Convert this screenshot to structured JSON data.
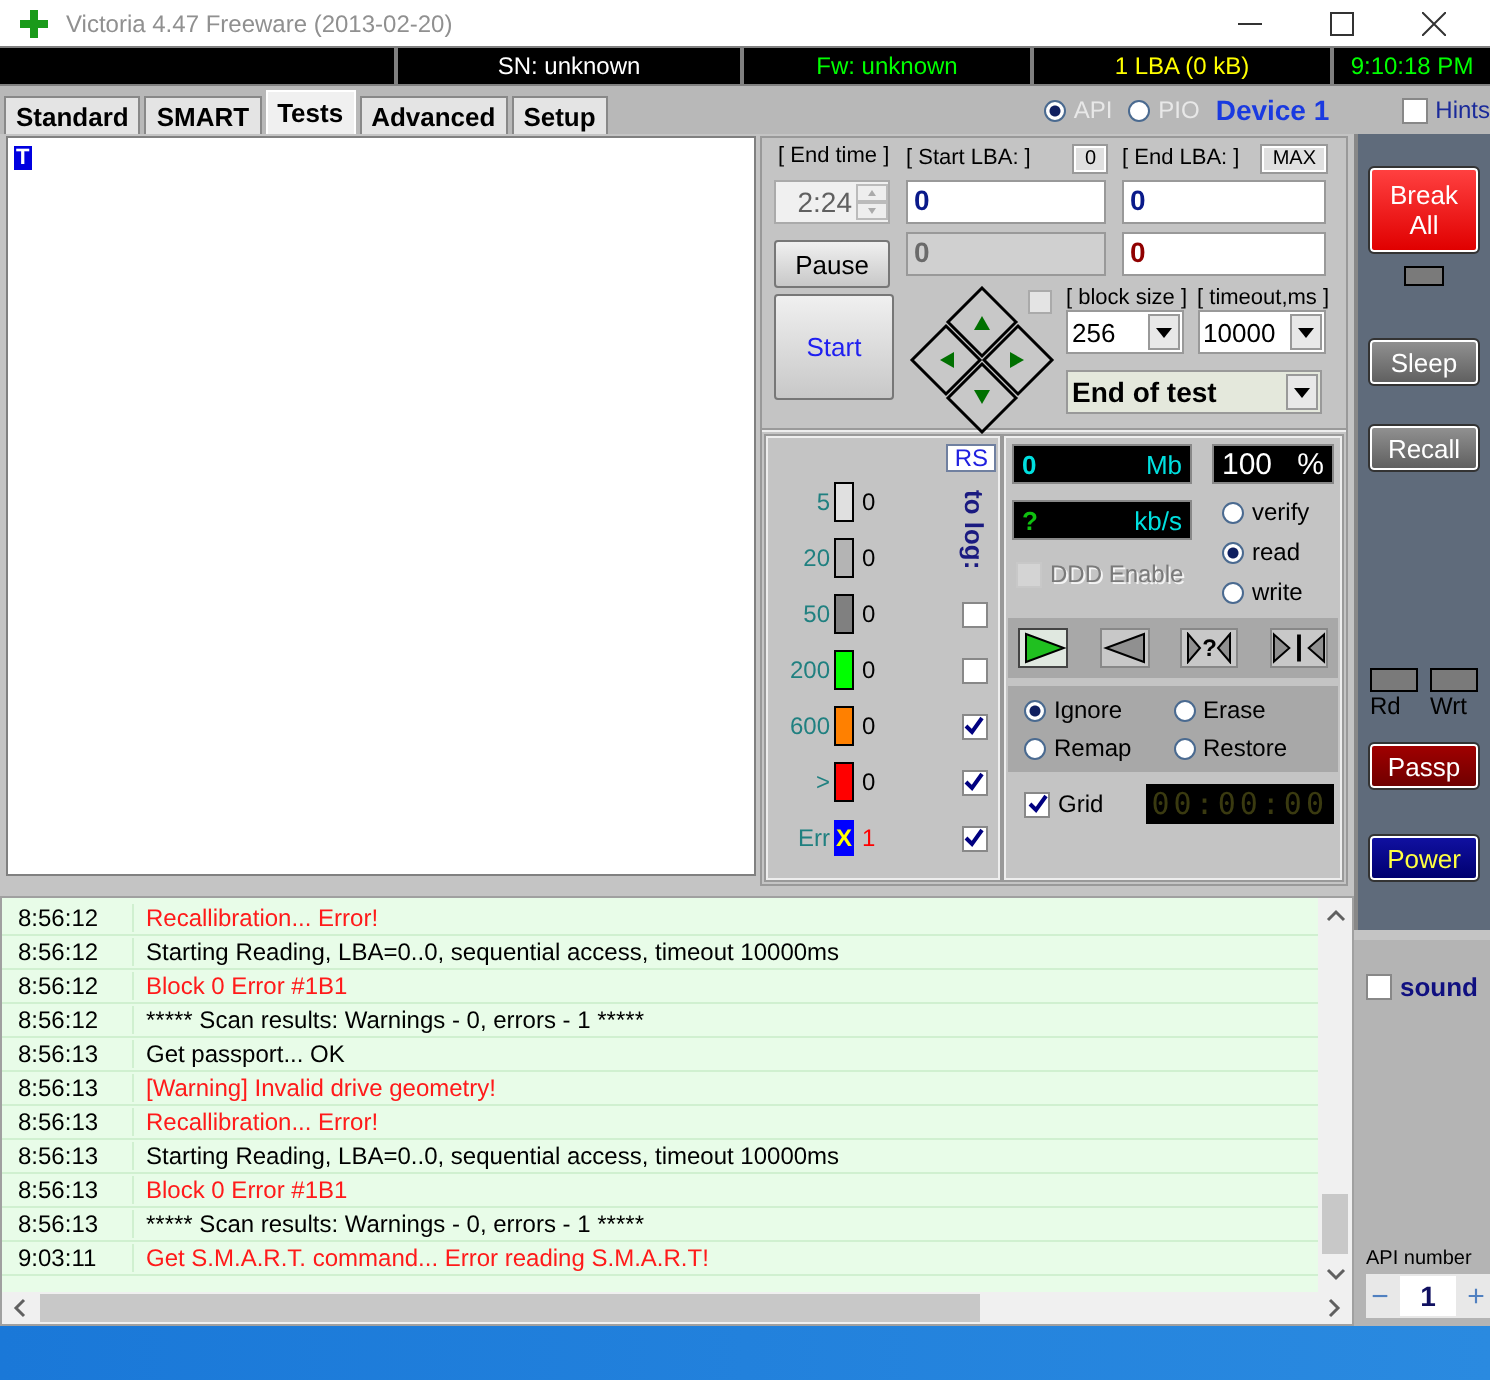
{
  "window": {
    "title": "Victoria 4.47  Freeware (2013-02-20)"
  },
  "status_strip": [
    {
      "text": "SN: unknown",
      "kind": "serial"
    },
    {
      "text": "Fw: unknown",
      "kind": "firmware"
    },
    {
      "text": "1 LBA (0 kB)",
      "kind": "capacity"
    },
    {
      "text": "9:10:18 PM",
      "kind": "clock"
    }
  ],
  "tabs": [
    {
      "label": "Standard",
      "selected": false
    },
    {
      "label": "SMART",
      "selected": false
    },
    {
      "label": "Tests",
      "selected": true
    },
    {
      "label": "Advanced",
      "selected": false
    },
    {
      "label": "Setup",
      "selected": false
    }
  ],
  "interface": [
    {
      "label": "API",
      "selected": true,
      "disabled": true
    },
    {
      "label": "PIO",
      "selected": false,
      "disabled": true
    }
  ],
  "device": "Device 1",
  "hints": {
    "label": "Hints",
    "checked": false
  },
  "editor": {
    "selected_text": "T"
  },
  "scan": {
    "end_time_label": "[ End time ]",
    "end_time": "2:24",
    "start_lba_label": "[ Start LBA: ]",
    "zero_button": "0",
    "end_lba_label": "[ End LBA: ]",
    "max_button": "MAX",
    "start_lba": "0",
    "end_lba": "0",
    "current_lba": "0",
    "current_end": "0",
    "pause_button": "Pause",
    "start_button": "Start",
    "option_checked": false,
    "block_size_label": "[ block size ]",
    "block_size": "256",
    "timeout_label": "[ timeout,ms ]",
    "timeout": "10000",
    "mode": "End of test"
  },
  "rs_button": "RS",
  "to_log_label": "to log:",
  "legend": [
    {
      "kind": "bar",
      "label": "5",
      "color": "#e0e0e0",
      "count": "0"
    },
    {
      "kind": "bar",
      "label": "20",
      "color": "#b4b4b4",
      "count": "0"
    },
    {
      "kind": "bar",
      "label": "50",
      "color": "#808080",
      "count": "0",
      "log": false
    },
    {
      "kind": "bar",
      "label": "200",
      "color": "#00ff00",
      "count": "0",
      "log": false
    },
    {
      "kind": "bar",
      "label": "600",
      "color": "#ff8000",
      "count": "0",
      "log": true
    },
    {
      "kind": "bar",
      "label": ">",
      "color": "#ff0000",
      "count": "0",
      "log": true
    },
    {
      "kind": "error",
      "label": "Err",
      "color": "#0000ff",
      "marker": "X",
      "count": "1",
      "log": true
    }
  ],
  "meters": {
    "mb": "0",
    "mb_unit": "Mb",
    "percent": "100",
    "percent_unit": "%",
    "speed": "?",
    "speed_unit": "kb/s"
  },
  "ddd": {
    "label": "DDD Enable",
    "checked": false,
    "disabled": true
  },
  "access": [
    {
      "label": "verify",
      "selected": false
    },
    {
      "label": "read",
      "selected": true
    },
    {
      "label": "write",
      "selected": false
    }
  ],
  "direction_buttons": [
    {
      "kind": "forward",
      "selected": true
    },
    {
      "kind": "backward",
      "selected": false
    },
    {
      "kind": "random",
      "label": "?",
      "selected": false
    },
    {
      "kind": "butterfly",
      "selected": false
    }
  ],
  "error_actions": [
    {
      "label": "Ignore",
      "selected": true
    },
    {
      "label": "Erase",
      "selected": false
    },
    {
      "label": "Remap",
      "selected": false
    },
    {
      "label": "Restore",
      "selected": false
    }
  ],
  "grid": {
    "label": "Grid",
    "checked": true
  },
  "timer": "00:00:00",
  "side_buttons": [
    {
      "kind": "break",
      "label": "Break All"
    },
    {
      "kind": "plain",
      "label": "Sleep"
    },
    {
      "kind": "plain",
      "label": "Recall"
    }
  ],
  "indicators": [
    {
      "label": "Rd"
    },
    {
      "label": "Wrt"
    }
  ],
  "side_buttons_lower": [
    {
      "kind": "passport",
      "label": "Passp"
    },
    {
      "kind": "power",
      "label": "Power"
    }
  ],
  "log": [
    {
      "time": "8:56:12",
      "text": "Recallibration... Error!",
      "kind": "error"
    },
    {
      "time": "8:56:12",
      "text": "Starting Reading, LBA=0..0, sequential access, timeout 10000ms",
      "kind": "info"
    },
    {
      "time": "8:56:12",
      "text": "Block 0 Error #1B1",
      "kind": "error"
    },
    {
      "time": "8:56:12",
      "text": "***** Scan results: Warnings - 0, errors - 1 *****",
      "kind": "info"
    },
    {
      "time": "8:56:13",
      "text": "Get passport... OK",
      "kind": "info"
    },
    {
      "time": "8:56:13",
      "text": "[Warning] Invalid drive geometry!",
      "kind": "error"
    },
    {
      "time": "8:56:13",
      "text": "Recallibration... Error!",
      "kind": "error"
    },
    {
      "time": "8:56:13",
      "text": "Starting Reading, LBA=0..0, sequential access, timeout 10000ms",
      "kind": "info"
    },
    {
      "time": "8:56:13",
      "text": "Block 0 Error #1B1",
      "kind": "error"
    },
    {
      "time": "8:56:13",
      "text": "***** Scan results: Warnings - 0, errors - 1 *****",
      "kind": "info"
    },
    {
      "time": "9:03:11",
      "text": "Get S.M.A.R.T. command... Error reading S.M.A.R.T!",
      "kind": "error"
    }
  ],
  "sound": {
    "label": "sound",
    "checked": false
  },
  "api_number": {
    "label": "API number",
    "value": "1",
    "minus": "−",
    "plus": "+"
  }
}
